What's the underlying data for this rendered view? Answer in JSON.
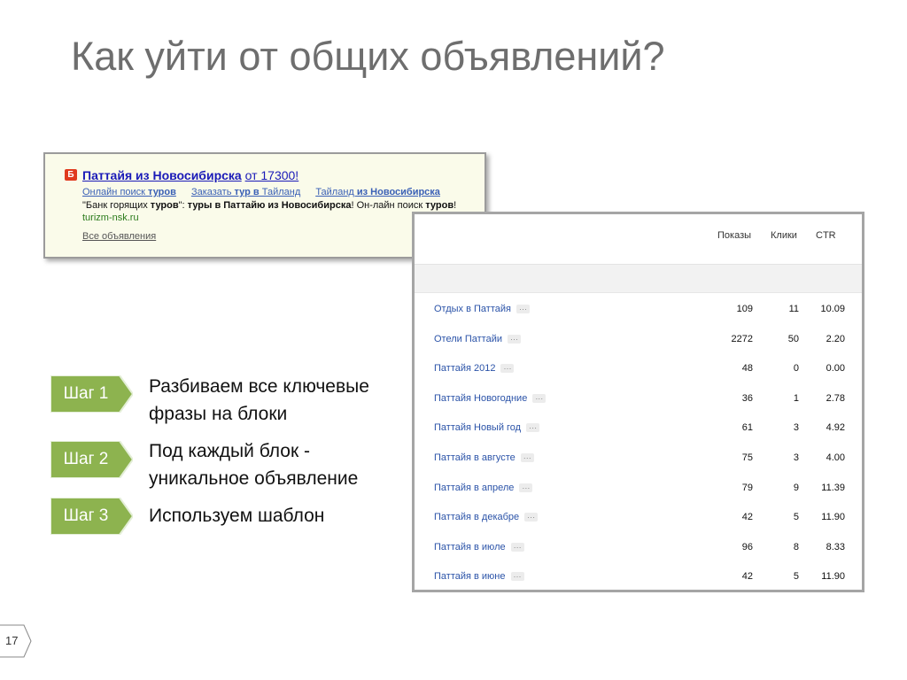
{
  "slide": {
    "title": "Как уйти от общих объявлений?",
    "page_number": "17"
  },
  "ad": {
    "favicon": "Б",
    "title_bold": "Паттайя из Новосибирска",
    "title_rest": "от 17300!",
    "links": [
      {
        "pre": "Онлайн поиск ",
        "bold": "туров",
        "post": ""
      },
      {
        "pre": "Заказать ",
        "bold": "тур в",
        "post": " Тайланд"
      },
      {
        "pre": "Тайланд ",
        "bold": "из Новосибирска",
        "post": ""
      }
    ],
    "text_1": "\"Банк горящих ",
    "text_2": "туров",
    "text_3": "\": ",
    "text_4": "туры в Паттайю из Новосибирска",
    "text_5": "! Он-лайн поиск ",
    "text_6": "туров",
    "text_7": "!",
    "domain": "turizm-nsk.ru",
    "all_ads": "Все объявления"
  },
  "table": {
    "headers": {
      "shows": "Показы",
      "clicks": "Клики",
      "ctr": "CTR"
    },
    "dots_label": "···",
    "rows": [
      {
        "keyword": "Отдых в Паттайя",
        "shows": "109",
        "clicks": "11",
        "ctr": "10.09"
      },
      {
        "keyword": "Отели Паттайи",
        "shows": "2272",
        "clicks": "50",
        "ctr": "2.20"
      },
      {
        "keyword": "Паттайя 2012",
        "shows": "48",
        "clicks": "0",
        "ctr": "0.00"
      },
      {
        "keyword": "Паттайя Новогодние",
        "shows": "36",
        "clicks": "1",
        "ctr": "2.78"
      },
      {
        "keyword": "Паттайя Новый год",
        "shows": "61",
        "clicks": "3",
        "ctr": "4.92"
      },
      {
        "keyword": "Паттайя в августе",
        "shows": "75",
        "clicks": "3",
        "ctr": "4.00"
      },
      {
        "keyword": "Паттайя в апреле",
        "shows": "79",
        "clicks": "9",
        "ctr": "11.39"
      },
      {
        "keyword": "Паттайя в декабре",
        "shows": "42",
        "clicks": "5",
        "ctr": "11.90"
      },
      {
        "keyword": "Паттайя в июле",
        "shows": "96",
        "clicks": "8",
        "ctr": "8.33"
      },
      {
        "keyword": "Паттайя в июне",
        "shows": "42",
        "clicks": "5",
        "ctr": "11.90"
      }
    ]
  },
  "steps": [
    {
      "label": "Шаг 1",
      "text_1": "Разбиваем все ключевые",
      "text_2": "фразы на блоки"
    },
    {
      "label": "Шаг 2",
      "text_1": "Под каждый блок -",
      "text_2": "уникальное объявление"
    },
    {
      "label": "Шаг 3",
      "text_1": "Используем шаблон",
      "text_2": ""
    }
  ],
  "colors": {
    "step_green": "#8db34f",
    "title_gray": "#6e6e6e",
    "link_blue": "#2b53a8"
  }
}
